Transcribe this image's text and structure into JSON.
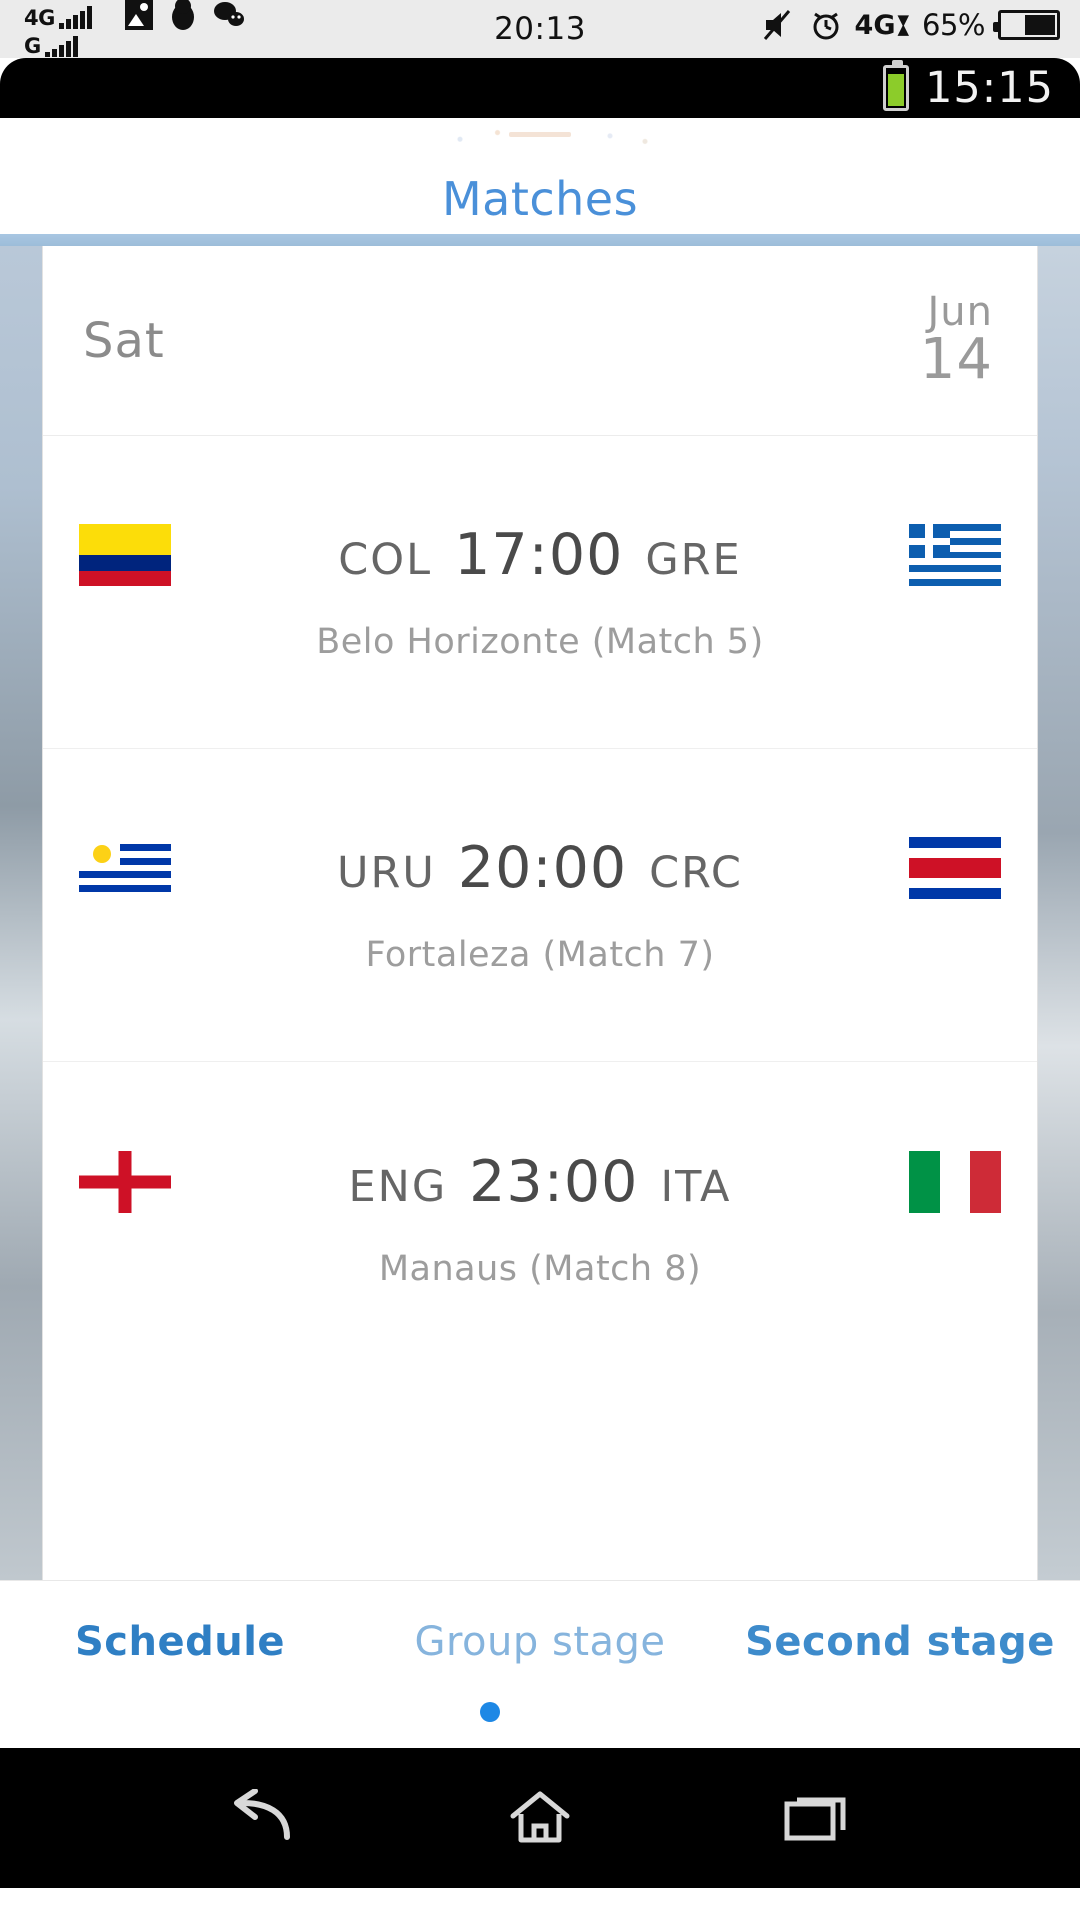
{
  "outer_status": {
    "network_primary": "4G",
    "network_secondary": "G",
    "clock": "20:13",
    "battery_percent": "65%",
    "icons": [
      "photo-icon",
      "penguin-icon",
      "chat-icon",
      "mute-icon",
      "alarm-icon",
      "data-4g-icon",
      "battery-icon"
    ]
  },
  "inner_status": {
    "clock": "15:15",
    "battery": "battery-icon"
  },
  "header": {
    "title": "Matches"
  },
  "schedule": {
    "date": {
      "day": "Sat",
      "month": "Jun",
      "number": "14"
    },
    "matches": [
      {
        "home_code": "COL",
        "away_code": "GRE",
        "time": "17:00",
        "venue": "Belo Horizonte (Match  5)",
        "home_flag": "colombia-flag",
        "away_flag": "greece-flag"
      },
      {
        "home_code": "URU",
        "away_code": "CRC",
        "time": "20:00",
        "venue": "Fortaleza (Match  7)",
        "home_flag": "uruguay-flag",
        "away_flag": "costa-rica-flag"
      },
      {
        "home_code": "ENG",
        "away_code": "ITA",
        "time": "23:00",
        "venue": "Manaus (Match  8)",
        "home_flag": "england-flag",
        "away_flag": "italy-flag"
      }
    ]
  },
  "tabs": [
    {
      "label": "Schedule",
      "state": "active"
    },
    {
      "label": "Group stage",
      "state": "inactive"
    },
    {
      "label": "Second stage",
      "state": "inactive"
    }
  ],
  "navbar": {
    "back": "back-icon",
    "home": "home-icon",
    "recents": "recents-icon"
  },
  "colors": {
    "accent_blue": "#4a90d9",
    "tab_active": "#2f7fc4",
    "tab_inactive": "#86b4dd",
    "band_blue": "#a8c6e2",
    "battery_green": "#8ccc2a",
    "text_grey": "#8b8b8b"
  }
}
